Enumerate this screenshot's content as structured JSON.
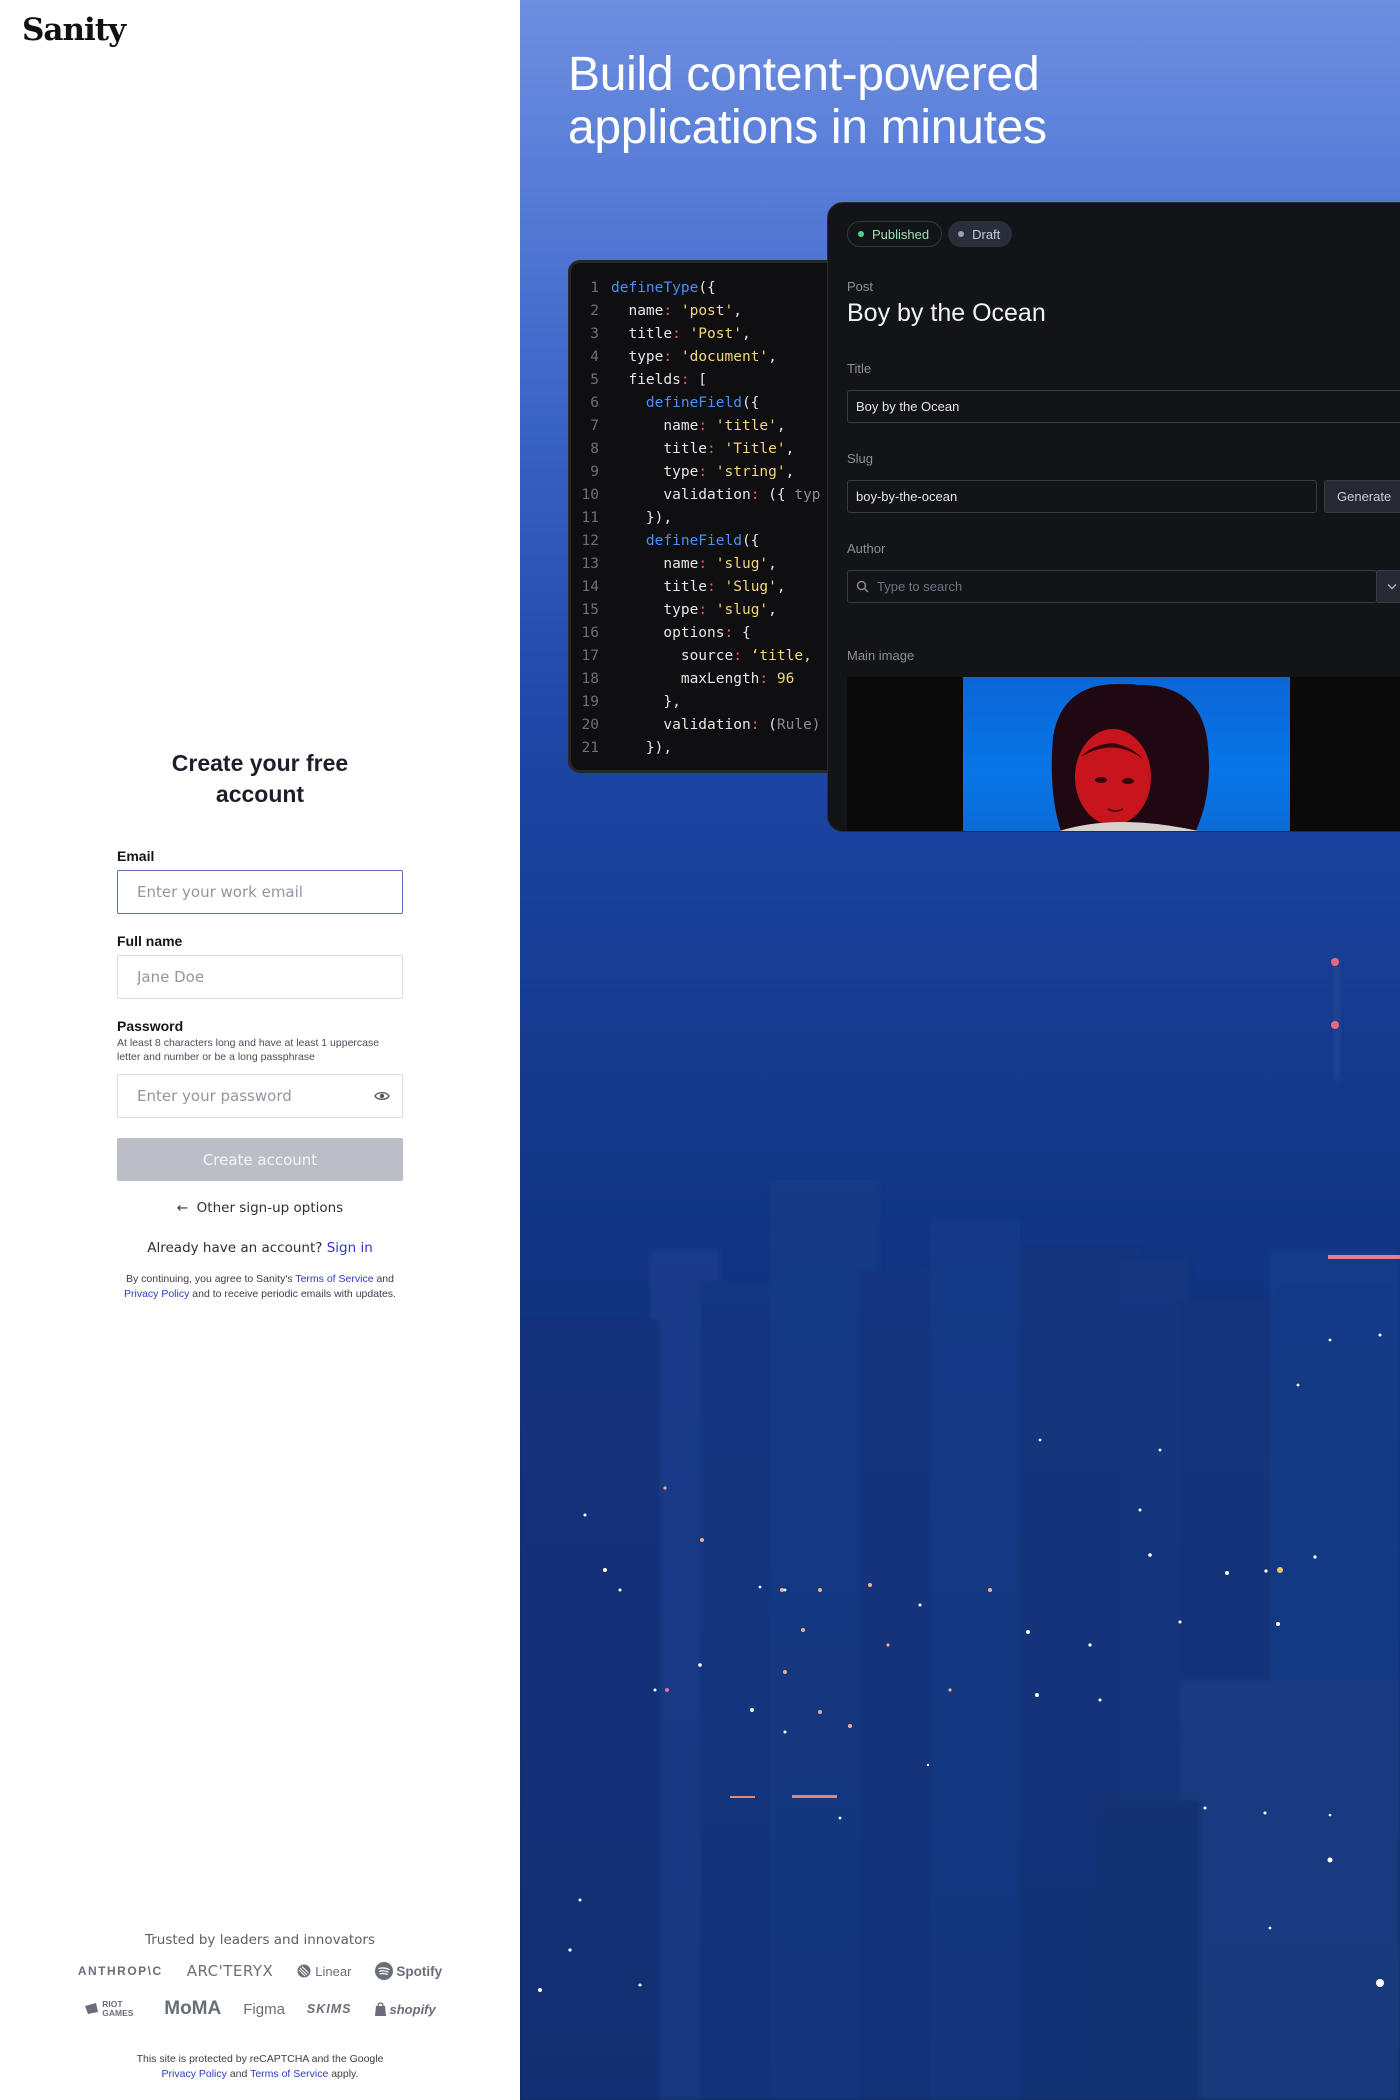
{
  "brand": {
    "logo_text": "Sanity"
  },
  "signup": {
    "title": "Create your free account",
    "email": {
      "label": "Email",
      "placeholder": "Enter your work email",
      "value": ""
    },
    "full_name": {
      "label": "Full name",
      "placeholder": "Jane Doe",
      "value": ""
    },
    "password": {
      "label": "Password",
      "hint": "At least 8 characters long and have at least 1 uppercase letter and number or be a long passphrase",
      "placeholder": "Enter your password",
      "value": ""
    },
    "create_button": "Create account",
    "other_options": "Other sign-up options",
    "already_text": "Already have an account?",
    "sign_in_link": "Sign in",
    "terms": {
      "prefix": "By continuing, you agree to Sanity's",
      "terms_link": "Terms of Service",
      "and": "and",
      "privacy_link": "Privacy Policy",
      "suffix": "and to receive periodic emails with updates."
    }
  },
  "trusted": {
    "label": "Trusted by leaders and innovators",
    "logos_row1": [
      "ANTHROP\\C",
      "ARC'TERYX",
      "Linear",
      "Spotify"
    ],
    "logos_row2": [
      "RIOT GAMES",
      "MoMA",
      "Figma",
      "SKIMS",
      "shopify"
    ]
  },
  "recaptcha": {
    "prefix": "This site is protected by reCAPTCHA and the Google",
    "privacy_link": "Privacy Policy",
    "and": "and",
    "terms_link": "Terms of Service",
    "suffix": "apply."
  },
  "hero": {
    "headline_line1": "Build content-powered",
    "headline_line2": "applications in minutes"
  },
  "code_editor": {
    "lines": [
      {
        "n": "1",
        "parts": [
          [
            "k",
            "defineType"
          ],
          [
            "t",
            "({"
          ]
        ]
      },
      {
        "n": "2",
        "parts": [
          [
            "t",
            "  name"
          ],
          [
            "p",
            ":"
          ],
          [
            "t",
            " "
          ],
          [
            "s",
            "'post'"
          ],
          [
            "t",
            ","
          ]
        ]
      },
      {
        "n": "3",
        "parts": [
          [
            "t",
            "  title"
          ],
          [
            "p",
            ":"
          ],
          [
            "t",
            " "
          ],
          [
            "s",
            "'Post'"
          ],
          [
            "t",
            ","
          ]
        ]
      },
      {
        "n": "4",
        "parts": [
          [
            "t",
            "  type"
          ],
          [
            "p",
            ":"
          ],
          [
            "t",
            " "
          ],
          [
            "s",
            "'document'"
          ],
          [
            "t",
            ","
          ]
        ]
      },
      {
        "n": "5",
        "parts": [
          [
            "t",
            "  fields"
          ],
          [
            "p",
            ":"
          ],
          [
            "t",
            " ["
          ]
        ]
      },
      {
        "n": "6",
        "parts": [
          [
            "t",
            "    "
          ],
          [
            "k",
            "defineField"
          ],
          [
            "t",
            "({"
          ]
        ]
      },
      {
        "n": "7",
        "parts": [
          [
            "t",
            "      name"
          ],
          [
            "p",
            ":"
          ],
          [
            "t",
            " "
          ],
          [
            "s",
            "'title'"
          ],
          [
            "t",
            ","
          ]
        ]
      },
      {
        "n": "8",
        "parts": [
          [
            "t",
            "      title"
          ],
          [
            "p",
            ":"
          ],
          [
            "t",
            " "
          ],
          [
            "s",
            "'Title'"
          ],
          [
            "t",
            ","
          ]
        ]
      },
      {
        "n": "9",
        "parts": [
          [
            "t",
            "      type"
          ],
          [
            "p",
            ":"
          ],
          [
            "t",
            " "
          ],
          [
            "s",
            "'string'"
          ],
          [
            "t",
            ","
          ]
        ]
      },
      {
        "n": "10",
        "parts": [
          [
            "t",
            "      validation"
          ],
          [
            "p",
            ":"
          ],
          [
            "t",
            " ({ "
          ],
          [
            "m",
            "typ"
          ]
        ]
      },
      {
        "n": "11",
        "parts": [
          [
            "t",
            "    }),"
          ]
        ]
      },
      {
        "n": "12",
        "parts": [
          [
            "t",
            "    "
          ],
          [
            "k",
            "defineField"
          ],
          [
            "t",
            "({"
          ]
        ]
      },
      {
        "n": "13",
        "parts": [
          [
            "t",
            "      name"
          ],
          [
            "p",
            ":"
          ],
          [
            "t",
            " "
          ],
          [
            "s",
            "'slug'"
          ],
          [
            "t",
            ","
          ]
        ]
      },
      {
        "n": "14",
        "parts": [
          [
            "t",
            "      title"
          ],
          [
            "p",
            ":"
          ],
          [
            "t",
            " "
          ],
          [
            "s",
            "'Slug'"
          ],
          [
            "t",
            ","
          ]
        ]
      },
      {
        "n": "15",
        "parts": [
          [
            "t",
            "      type"
          ],
          [
            "p",
            ":"
          ],
          [
            "t",
            " "
          ],
          [
            "s",
            "'slug'"
          ],
          [
            "t",
            ","
          ]
        ]
      },
      {
        "n": "16",
        "parts": [
          [
            "t",
            "      options"
          ],
          [
            "p",
            ":"
          ],
          [
            "t",
            " {"
          ]
        ]
      },
      {
        "n": "17",
        "parts": [
          [
            "t",
            "        source"
          ],
          [
            "p",
            ":"
          ],
          [
            "t",
            " "
          ],
          [
            "s",
            "‘title,"
          ]
        ]
      },
      {
        "n": "18",
        "parts": [
          [
            "t",
            "        maxLength"
          ],
          [
            "p",
            ":"
          ],
          [
            "t",
            " "
          ],
          [
            "s",
            "96"
          ]
        ]
      },
      {
        "n": "19",
        "parts": [
          [
            "t",
            "      },"
          ]
        ]
      },
      {
        "n": "20",
        "parts": [
          [
            "t",
            "      validation"
          ],
          [
            "p",
            ":"
          ],
          [
            "t",
            " ("
          ],
          [
            "m",
            "Rule)"
          ]
        ]
      },
      {
        "n": "21",
        "parts": [
          [
            "t",
            "    }),"
          ]
        ]
      }
    ]
  },
  "studio": {
    "status_published": "Published",
    "status_draft": "Draft",
    "doc_type": "Post",
    "doc_title": "Boy by the Ocean",
    "title_field": {
      "label": "Title",
      "value": "Boy by the Ocean"
    },
    "slug_field": {
      "label": "Slug",
      "value": "boy-by-the-ocean",
      "generate_button": "Generate"
    },
    "author_field": {
      "label": "Author",
      "placeholder": "Type to search"
    },
    "main_image_label": "Main image"
  },
  "colors": {
    "accent_link": "#2c3bbd",
    "button_disabled": "#bcbec7",
    "published_dot": "#4fd18b"
  }
}
